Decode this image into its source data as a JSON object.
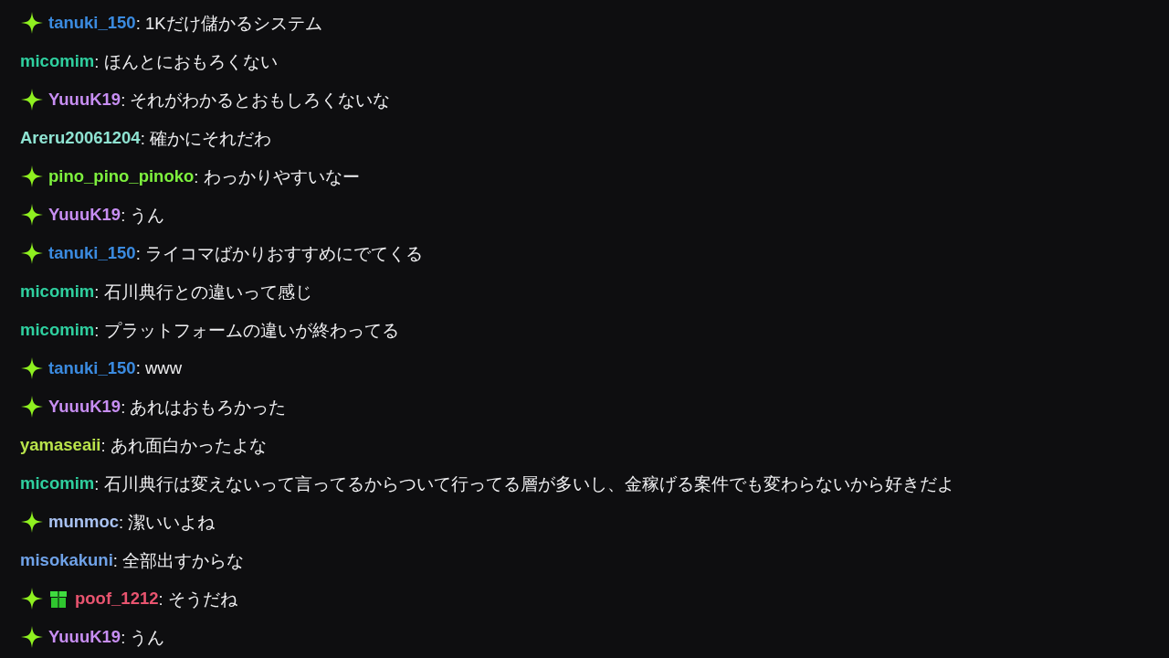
{
  "messages": [
    {
      "badges": [
        {
          "kind": "sparkle"
        }
      ],
      "user": "tanuki_150",
      "color": "#3b8be0",
      "separator": ":",
      "text": "1Kだけ儲かるシステム"
    },
    {
      "user": "micomim",
      "color": "#2fcf9f",
      "separator": ":",
      "text": "ほんとにおもろくない"
    },
    {
      "badges": [
        {
          "kind": "sparkle"
        }
      ],
      "user": "YuuuK19",
      "color": "#c78ef2",
      "separator": ":",
      "text": "それがわかるとおもしろくないな"
    },
    {
      "user": "Areru20061204",
      "color": "#8fe3d2",
      "separator": ":",
      "text": "確かにそれだわ"
    },
    {
      "badges": [
        {
          "kind": "sparkle"
        }
      ],
      "user": "pino_pino_pinoko",
      "color": "#7ef03e",
      "separator": ":",
      "text": "わっかりやすいなー"
    },
    {
      "badges": [
        {
          "kind": "sparkle"
        }
      ],
      "user": "YuuuK19",
      "color": "#c78ef2",
      "separator": ":",
      "text": "うん"
    },
    {
      "badges": [
        {
          "kind": "sparkle"
        }
      ],
      "user": "tanuki_150",
      "color": "#3b8be0",
      "separator": ":",
      "text": "ライコマばかりおすすめにでてくる"
    },
    {
      "user": "micomim",
      "color": "#2fcf9f",
      "separator": ":",
      "text": "石川典行との違いって感じ"
    },
    {
      "user": "micomim",
      "color": "#2fcf9f",
      "separator": ":",
      "text": "プラットフォームの違いが終わってる"
    },
    {
      "badges": [
        {
          "kind": "sparkle"
        }
      ],
      "user": "tanuki_150",
      "color": "#3b8be0",
      "separator": ":",
      "text": "www"
    },
    {
      "badges": [
        {
          "kind": "sparkle"
        }
      ],
      "user": "YuuuK19",
      "color": "#c78ef2",
      "separator": ":",
      "text": "あれはおもろかった"
    },
    {
      "user": "yamaseaii",
      "color": "#b9e34b",
      "separator": ":",
      "text": "あれ面白かったよな"
    },
    {
      "user": "micomim",
      "color": "#2fcf9f",
      "separator": ":",
      "text": "石川典行は変えないって言ってるからついて行ってる層が多いし、金稼げる案件でも変わらないから好きだよ"
    },
    {
      "badges": [
        {
          "kind": "sparkle"
        }
      ],
      "user": "munmoc",
      "color": "#a9c2f2",
      "separator": ":",
      "text": "潔いいよね"
    },
    {
      "user": "misokakuni",
      "color": "#6fa2e8",
      "separator": ":",
      "text": "全部出すからな"
    },
    {
      "badges": [
        {
          "kind": "sparkle"
        },
        {
          "kind": "gift"
        }
      ],
      "user": "poof_1212",
      "color": "#e8546f",
      "separator": ":",
      "text": "そうだね"
    },
    {
      "badges": [
        {
          "kind": "sparkle"
        }
      ],
      "user": "YuuuK19",
      "color": "#c78ef2",
      "separator": ":",
      "text": "うん"
    }
  ]
}
